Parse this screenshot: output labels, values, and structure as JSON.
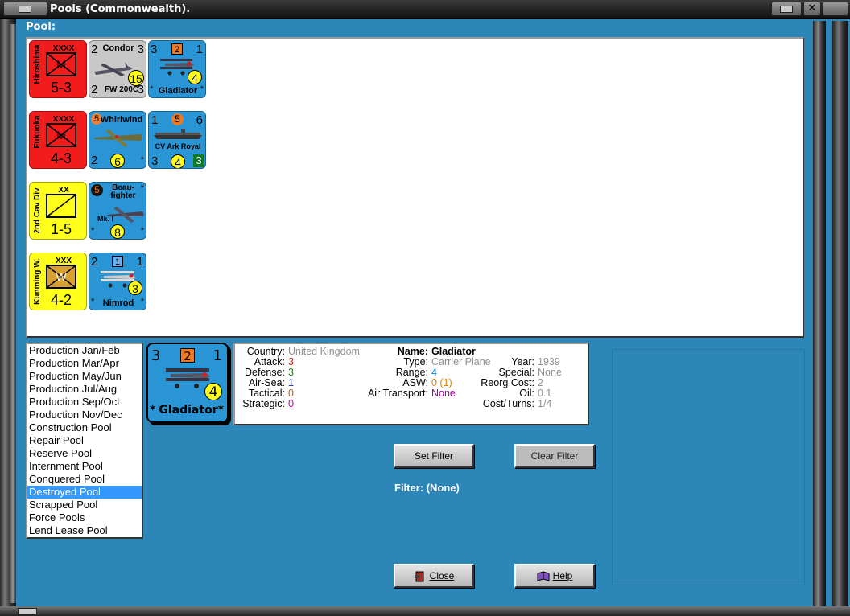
{
  "window": {
    "title": "Pools (Commonwealth).",
    "close_glyph": "✕"
  },
  "pool_label": "Pool:",
  "counters": [
    {
      "id": "hiroshima",
      "side_text": "Hiroshima",
      "size": "XXXX",
      "letter": "M",
      "strength": "5-3",
      "color": "#f21c1c"
    },
    {
      "id": "condor",
      "name_top": "Condor",
      "left_top": "2",
      "right_top": "3",
      "left_bottom": "2",
      "name_bottom": "FW 200C",
      "right_bottom": "3",
      "yellow": "15",
      "color": "#c8c8c8"
    },
    {
      "id": "gladiator",
      "left_top": "3",
      "badge": "2",
      "right_top": "1",
      "yellow": "4",
      "name_bottom": "Gladiator",
      "star": "*",
      "color": "#2a95d4"
    },
    {
      "id": "fukuoka",
      "side_text": "Fukuoka",
      "size": "XXXX",
      "letter": "M",
      "strength": "4-3",
      "color": "#f21c1c"
    },
    {
      "id": "whirlwind",
      "name_top": "Whirlwind",
      "badge": "5",
      "left_bottom": "2",
      "yellow": "6",
      "star": "*",
      "color": "#2a95d4"
    },
    {
      "id": "ark-royal",
      "left_top": "1",
      "badge": "5",
      "right_top": "6",
      "name_mid": "CV Ark Royal",
      "left_bottom": "3",
      "yellow": "4",
      "green": "3",
      "color": "#2a95d4"
    },
    {
      "id": "cav",
      "side_text": "2nd Cav Div",
      "size": "XX",
      "strength": "1-5",
      "color": "#ffff1a"
    },
    {
      "id": "beaufighter",
      "badge": "5",
      "name_top": "Beau-",
      "name_top2": "fighter",
      "name_mid": "Mk. I",
      "yellow": "8",
      "star": "*",
      "color": "#2a95d4"
    },
    {
      "id": "kunming",
      "side_text": "Kunming W.",
      "size": "XXX",
      "letter": "W",
      "strength": "4-2",
      "color": "#ffff1a"
    },
    {
      "id": "nimrod",
      "left_top": "2",
      "badge": "1",
      "right_top": "1",
      "yellow": "3",
      "name_bottom": "Nimrod",
      "star": "*",
      "color": "#2a95d4"
    }
  ],
  "pool_list": {
    "items": [
      "Production Jan/Feb",
      "Production Mar/Apr",
      "Production May/Jun",
      "Production Jul/Aug",
      "Production Sep/Oct",
      "Production Nov/Dec",
      "Construction Pool",
      "Repair Pool",
      "Reserve Pool",
      "Internment Pool",
      "Conquered Pool",
      "Destroyed Pool",
      "Scrapped Pool",
      "Force Pools",
      "Lend Lease Pool"
    ],
    "selected": "Destroyed Pool"
  },
  "detail": {
    "counter": {
      "left_top": "3",
      "badge": "2",
      "right_top": "1",
      "yellow": "4",
      "name": "Gladiator",
      "star": "*"
    },
    "country_label": "Country:",
    "country": "United Kingdom",
    "attack_label": "Attack:",
    "attack": "3",
    "defense_label": "Defense:",
    "defense": "3",
    "airsea_label": "Air-Sea:",
    "airsea": "1",
    "tactical_label": "Tactical:",
    "tactical": "0",
    "strategic_label": "Strategic:",
    "strategic": "0",
    "name_label": "Name:",
    "name": "Gladiator",
    "type_label": "Type:",
    "type": "Carrier Plane",
    "year_label": "Year:",
    "year": "1939",
    "range_label": "Range:",
    "range": "4",
    "special_label": "Special:",
    "special": "None",
    "asw_label": "ASW:",
    "asw": "0 (1)",
    "reorg_label": "Reorg Cost:",
    "reorg": "2",
    "airtransport_label": "Air Transport:",
    "airtransport": "None",
    "oil_label": "Oil:",
    "oil": "0.1",
    "cost_label": "Cost/Turns:",
    "cost": "1/4"
  },
  "buttons": {
    "set_filter": "Set Filter",
    "clear_filter": "Clear Filter",
    "close": "Close",
    "help": "Help"
  },
  "filter_text": "Filter: (None)",
  "colors": {
    "background": "#2d86b8",
    "attack": "#e01010",
    "defense": "#109010",
    "airsea": "#1030c0",
    "tactical": "#c06000",
    "strategic": "#c000c0",
    "grey_value": "#909090",
    "range": "#1080c0",
    "asw": "#e08000",
    "airtransport": "#a000a0",
    "selected": "#3399ff"
  }
}
